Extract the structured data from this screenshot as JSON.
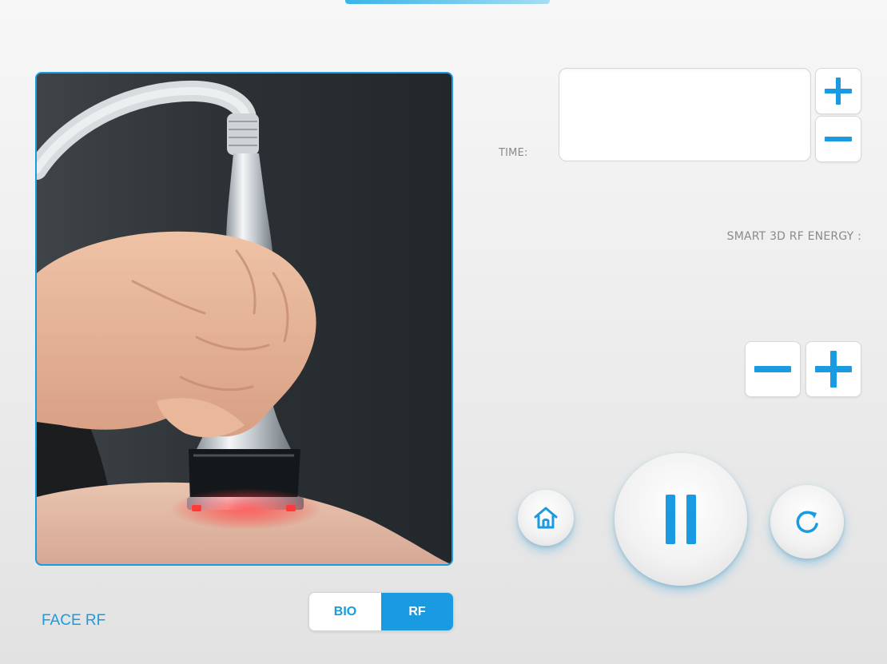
{
  "colors": {
    "accent": "#1a9ae0",
    "label_gray": "#8a8a8a",
    "background": "#ececec"
  },
  "time": {
    "label": "TIME:",
    "value": "",
    "increase_icon": "plus-icon",
    "decrease_icon": "minus-icon"
  },
  "energy": {
    "label": "SMART 3D RF ENERGY :",
    "decrease_icon": "minus-icon",
    "increase_icon": "plus-icon"
  },
  "controls": {
    "home_icon": "home-icon",
    "pause_icon": "pause-icon",
    "reset_icon": "refresh-icon"
  },
  "mode": {
    "title": "FACE RF",
    "options": [
      "BIO",
      "RF"
    ],
    "selected": "RF"
  }
}
